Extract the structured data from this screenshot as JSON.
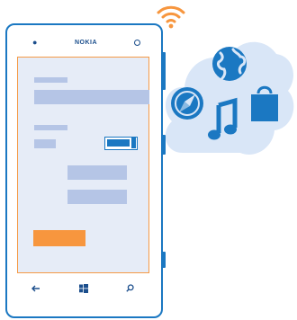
{
  "phone": {
    "brand": "NOKIA"
  },
  "colors": {
    "phone_outline": "#1b78c2",
    "screen_background": "#e6ecf7",
    "screen_border": "#f59a46",
    "placeholder_bar": "#b5c5e6",
    "accent": "#f7963e",
    "cloud": "#d9e6f7",
    "wifi": "#f7963e"
  },
  "icons": {
    "wifi": "wifi-icon",
    "globe": "globe-icon",
    "compass": "compass-icon",
    "music": "music-note-icon",
    "store": "shopping-bag-icon",
    "back": "back-arrow-icon",
    "start": "windows-start-icon",
    "search": "search-icon",
    "carrier": "carrier-logo-icon",
    "camera": "front-camera-icon"
  },
  "toggle": {
    "state": "on"
  }
}
